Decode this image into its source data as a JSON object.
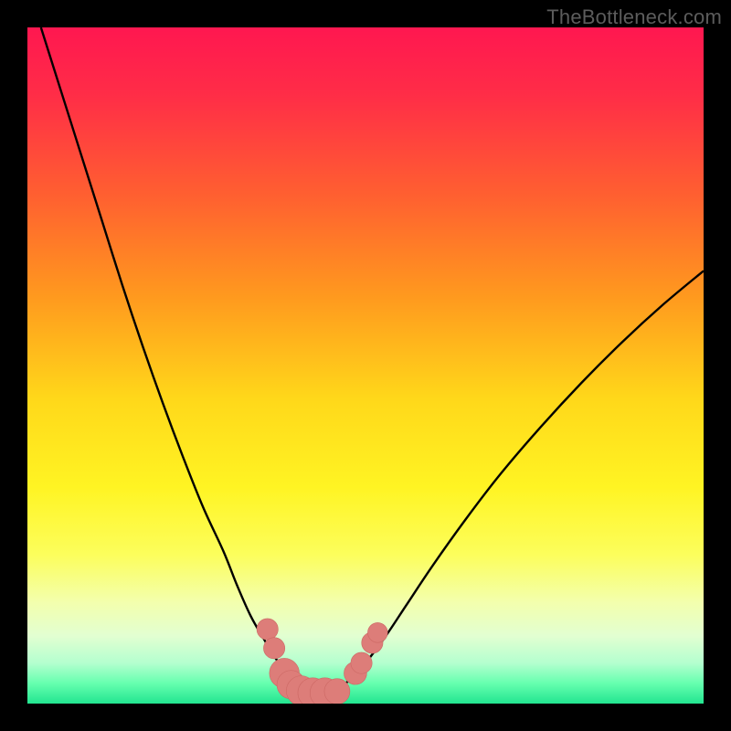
{
  "watermark": "TheBottleneck.com",
  "colors": {
    "frame": "#000000",
    "curve_stroke": "#000000",
    "marker_fill": "#dd7d79",
    "marker_stroke": "#cc6864",
    "gradient_stops": [
      {
        "offset": 0.0,
        "color": "#ff1750"
      },
      {
        "offset": 0.1,
        "color": "#ff2d47"
      },
      {
        "offset": 0.25,
        "color": "#ff6030"
      },
      {
        "offset": 0.4,
        "color": "#ff9a1e"
      },
      {
        "offset": 0.55,
        "color": "#ffd81a"
      },
      {
        "offset": 0.68,
        "color": "#fff423"
      },
      {
        "offset": 0.78,
        "color": "#fcfe5c"
      },
      {
        "offset": 0.85,
        "color": "#f3ffad"
      },
      {
        "offset": 0.9,
        "color": "#e2ffd1"
      },
      {
        "offset": 0.94,
        "color": "#b4ffcf"
      },
      {
        "offset": 0.97,
        "color": "#66ffaf"
      },
      {
        "offset": 1.0,
        "color": "#22e590"
      }
    ]
  },
  "chart_data": {
    "type": "line",
    "title": "",
    "xlabel": "",
    "ylabel": "",
    "xlim": [
      0,
      100
    ],
    "ylim": [
      0,
      100
    ],
    "note": "x is normalized horizontal position (0=left edge of plot, 100=right). y is normalized bottleneck percentage (0=bottom/no bottleneck, 100=top/severe bottleneck). Two curves form a V; markers sit near the trough.",
    "series": [
      {
        "name": "left-curve",
        "x": [
          2,
          5,
          8,
          11,
          14,
          17,
          20,
          23,
          26,
          29,
          31,
          33,
          35,
          36.5,
          38,
          39.5,
          41
        ],
        "y": [
          100,
          90.5,
          81,
          71.5,
          62,
          53,
          44.5,
          36.5,
          29,
          22.5,
          17.5,
          13,
          9.5,
          7,
          5,
          3.5,
          2.2
        ]
      },
      {
        "name": "right-curve",
        "x": [
          46,
          48,
          50,
          53,
          56,
          60,
          65,
          70,
          76,
          82,
          88,
          94,
          100
        ],
        "y": [
          2.2,
          3.8,
          6,
          10,
          14.5,
          20.5,
          27.5,
          34,
          41,
          47.5,
          53.5,
          59,
          64
        ]
      }
    ],
    "markers": [
      {
        "x": 35.5,
        "y": 11.0,
        "r": 1.5
      },
      {
        "x": 36.5,
        "y": 8.2,
        "r": 1.5
      },
      {
        "x": 38.0,
        "y": 4.5,
        "r": 2.1
      },
      {
        "x": 39.0,
        "y": 2.8,
        "r": 2.0
      },
      {
        "x": 40.5,
        "y": 1.9,
        "r": 2.1
      },
      {
        "x": 42.2,
        "y": 1.6,
        "r": 2.1
      },
      {
        "x": 44.0,
        "y": 1.6,
        "r": 2.1
      },
      {
        "x": 45.8,
        "y": 1.8,
        "r": 1.8
      },
      {
        "x": 48.5,
        "y": 4.5,
        "r": 1.6
      },
      {
        "x": 49.4,
        "y": 6.0,
        "r": 1.5
      },
      {
        "x": 51.0,
        "y": 9.0,
        "r": 1.5
      },
      {
        "x": 51.8,
        "y": 10.5,
        "r": 1.4
      }
    ]
  }
}
